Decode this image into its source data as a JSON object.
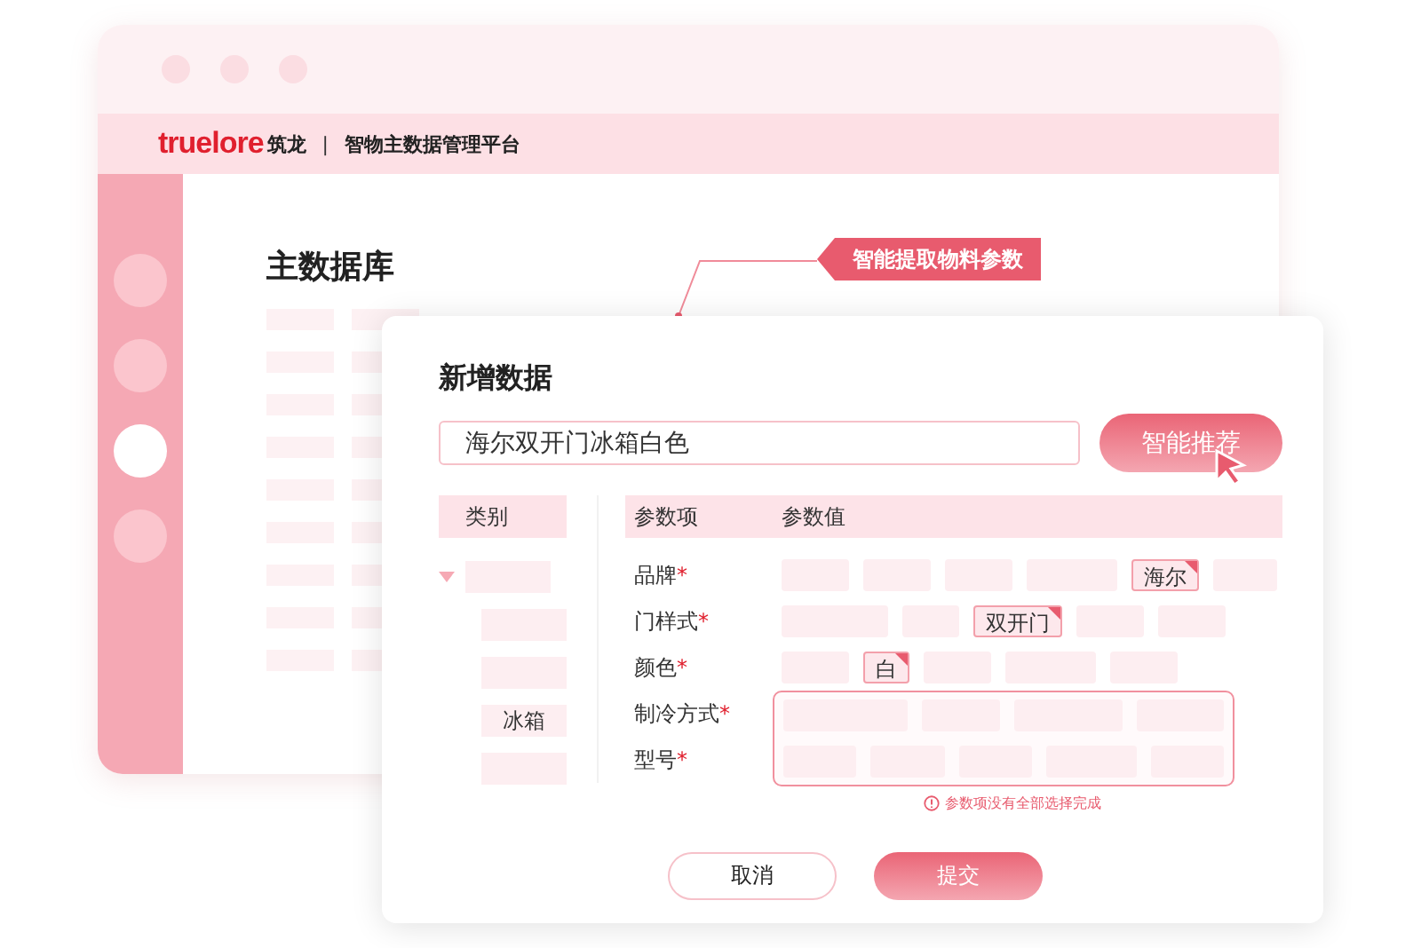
{
  "window": {
    "brand": "truelore",
    "brand_cn": "筑龙",
    "separator": "|",
    "platform": "智物主数据管理平台"
  },
  "sidebar": {
    "items": [
      {
        "selected": false
      },
      {
        "selected": false
      },
      {
        "selected": true
      },
      {
        "selected": false
      }
    ]
  },
  "page_title": "主数据库",
  "callout": "智能提取物料参数",
  "dialog": {
    "title": "新增数据",
    "search": {
      "value": "海尔双开门冰箱白色"
    },
    "recommend_button": "智能推荐",
    "category_header": "类别",
    "categories": [
      {
        "kind": "group"
      },
      {
        "kind": "blank"
      },
      {
        "kind": "blank"
      },
      {
        "kind": "text",
        "label": "冰箱"
      },
      {
        "kind": "blank"
      }
    ],
    "param_headers": [
      "参数项",
      "参数值"
    ],
    "params": [
      {
        "name": "品牌",
        "mark": "*",
        "error": false,
        "options": [
          {
            "selected": false
          },
          {
            "selected": false
          },
          {
            "selected": false
          },
          {
            "selected": false
          },
          {
            "label": "海尔",
            "selected": true
          },
          {
            "selected": false
          }
        ]
      },
      {
        "name": "门样式",
        "mark": "*",
        "error": false,
        "options": [
          {
            "selected": false
          },
          {
            "selected": false
          },
          {
            "label": "双开门",
            "selected": true
          },
          {
            "selected": false
          },
          {
            "selected": false
          }
        ]
      },
      {
        "name": "颜色",
        "mark": "*",
        "error": false,
        "options": [
          {
            "selected": false
          },
          {
            "label": "白",
            "selected": true
          },
          {
            "selected": false
          },
          {
            "selected": false
          },
          {
            "selected": false
          }
        ]
      },
      {
        "name": "制冷方式",
        "mark": "*",
        "error": true,
        "options": [
          {
            "selected": false
          },
          {
            "selected": false
          },
          {
            "selected": false
          },
          {
            "selected": false
          }
        ]
      },
      {
        "name": "型号",
        "mark": "*",
        "error": true,
        "options": [
          {
            "selected": false
          },
          {
            "selected": false
          },
          {
            "selected": false
          },
          {
            "selected": false
          },
          {
            "selected": false
          }
        ]
      }
    ],
    "error_message": "参数项没有全部选择完成",
    "buttons": [
      {
        "label": "取消",
        "kind": "secondary"
      },
      {
        "label": "提交",
        "kind": "primary"
      }
    ]
  }
}
